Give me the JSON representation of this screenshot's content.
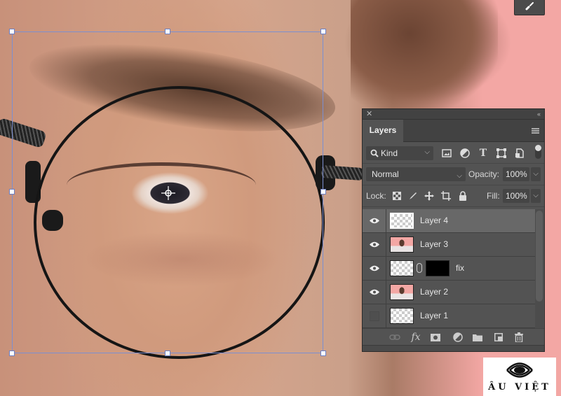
{
  "canvas": {
    "description": "close-up photo of eye behind round glasses",
    "background_color": "#f3a7a4",
    "transform_box_color": "#7c8fd0"
  },
  "top_tool": {
    "icon": "brush-icon"
  },
  "layers_panel": {
    "close_glyph": "✕",
    "collapse_glyph": "‹‹",
    "tab_label": "Layers",
    "menu_icon": "panel-menu-icon",
    "filter": {
      "kind_label": "Kind",
      "icons": [
        "pixel-layer-filter-icon",
        "adjustment-layer-filter-icon",
        "type-layer-filter-icon",
        "shape-layer-filter-icon",
        "smart-object-filter-icon"
      ]
    },
    "blend_mode": "Normal",
    "opacity_label": "Opacity:",
    "opacity_value": "100%",
    "lock_label": "Lock:",
    "lock_icons": [
      "lock-transparent-pixels-icon",
      "lock-image-pixels-icon",
      "lock-position-icon",
      "lock-artboard-icon",
      "lock-all-icon"
    ],
    "fill_label": "Fill:",
    "fill_value": "100%",
    "layers": [
      {
        "name": "Layer 4",
        "visible": true,
        "selected": true,
        "thumb": "transparent",
        "mask": false
      },
      {
        "name": "Layer 3",
        "visible": true,
        "selected": false,
        "thumb": "photo",
        "mask": false
      },
      {
        "name": "fix",
        "visible": true,
        "selected": false,
        "thumb": "transparent",
        "mask": true
      },
      {
        "name": "Layer 2",
        "visible": true,
        "selected": false,
        "thumb": "photo",
        "mask": false
      },
      {
        "name": "Layer 1",
        "visible": false,
        "selected": false,
        "thumb": "transparent",
        "mask": false
      }
    ],
    "footer_icons": [
      "link-layers-icon",
      "fx-icon",
      "add-mask-icon",
      "adjustment-layer-icon",
      "new-group-icon",
      "new-layer-icon",
      "trash-icon"
    ],
    "fx_label": "fx"
  },
  "watermark": {
    "text": "ÂU VIỆT"
  }
}
